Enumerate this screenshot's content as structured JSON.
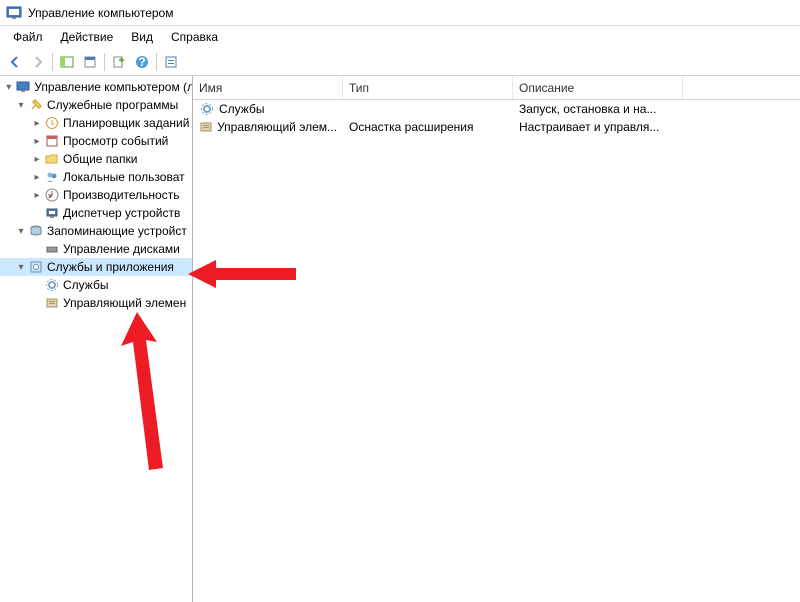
{
  "titlebar": {
    "text": "Управление компьютером"
  },
  "menubar": {
    "file": "Файл",
    "action": "Действие",
    "view": "Вид",
    "help": "Справка"
  },
  "tree": {
    "root": "Управление компьютером (л",
    "system_tools": "Служебные программы",
    "task_scheduler": "Планировщик заданий",
    "event_viewer": "Просмотр событий",
    "shared_folders": "Общие папки",
    "local_users": "Локальные пользоват",
    "performance": "Производительность",
    "device_manager": "Диспетчер устройств",
    "storage": "Запоминающие устройст",
    "disk_mgmt": "Управление дисками",
    "services_apps": "Службы и приложения",
    "services": "Службы",
    "wmi": "Управляющий элемен"
  },
  "list": {
    "headers": {
      "name": "Имя",
      "type": "Тип",
      "description": "Описание"
    },
    "rows": [
      {
        "name": "Службы",
        "type": "",
        "description": "Запуск, остановка и на..."
      },
      {
        "name": "Управляющий элем...",
        "type": "Оснастка расширения",
        "description": "Настраивает и управля..."
      }
    ]
  }
}
